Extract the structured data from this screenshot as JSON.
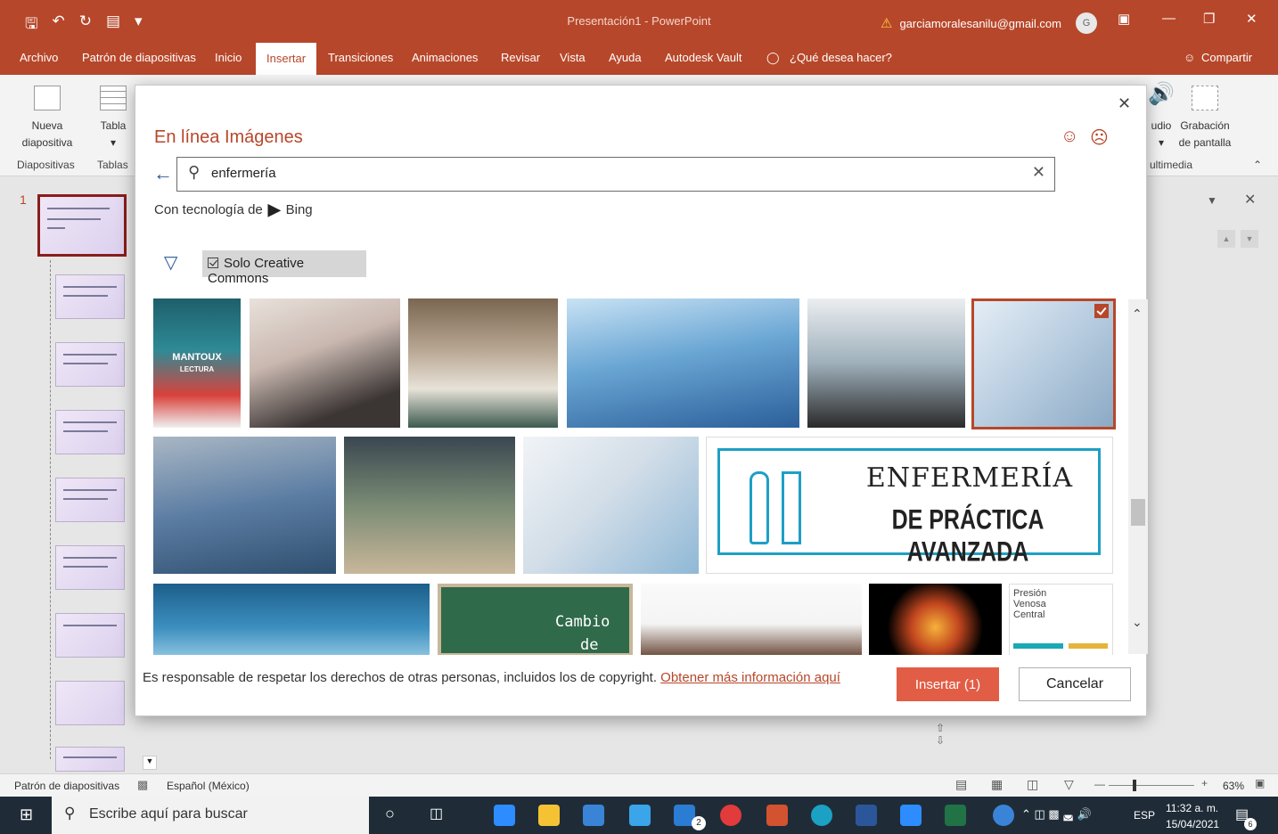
{
  "window": {
    "title": "Presentación1 - PowerPoint",
    "user_email": "garciamoralesanilu@gmail.com",
    "avatar_initial": "G"
  },
  "menu": {
    "tabs": [
      "Archivo",
      "Patrón de diapositivas",
      "Inicio",
      "Insertar",
      "Transiciones",
      "Animaciones",
      "Revisar",
      "Vista",
      "Ayuda",
      "Autodesk Vault",
      "¿Qué desea hacer?"
    ],
    "active_tab": "Insertar",
    "share": "Compartir"
  },
  "ribbon": {
    "new_slide_line1": "Nueva",
    "new_slide_line2": "diapositiva",
    "table": "Tabla",
    "group_slides": "Diapositivas",
    "group_tables": "Tablas",
    "audio": "udio",
    "screen_rec_line1": "Grabación",
    "screen_rec_line2": "de pantalla",
    "group_multimedia": "ultimedia"
  },
  "slide_panel": {
    "first_number": "1"
  },
  "dialog": {
    "title": "En línea Imágenes",
    "search_value": "enfermería",
    "powered_by": "Con tecnología de",
    "bing": "Bing",
    "filter_label": "Solo Creative Commons",
    "notice": "Es responsable de respetar los derechos de otras personas, incluidos los de copyright.",
    "notice_link": "Obtener más información aquí",
    "insert_button": "Insertar (1)",
    "cancel_button": "Cancelar"
  },
  "images": {
    "img1_title": "MANTOUX",
    "img1_sub": "LECTURA",
    "img12_line1": "ENFERMERÍA",
    "img12_line2": "DE PRÁCTICA AVANZADA",
    "img14_line1": "Cambio",
    "img14_line2": "de",
    "img17_line1": "Presión",
    "img17_line2": "Venosa",
    "img17_line3": "Central"
  },
  "status": {
    "view": "Patrón de diapositivas",
    "language": "Español (México)",
    "zoom": "63%"
  },
  "taskbar": {
    "search_placeholder": "Escribe aquí para buscar",
    "lang": "ESP",
    "time": "11:32 a. m.",
    "date": "15/04/2021",
    "notif_count": "6",
    "mail_count": "2"
  }
}
